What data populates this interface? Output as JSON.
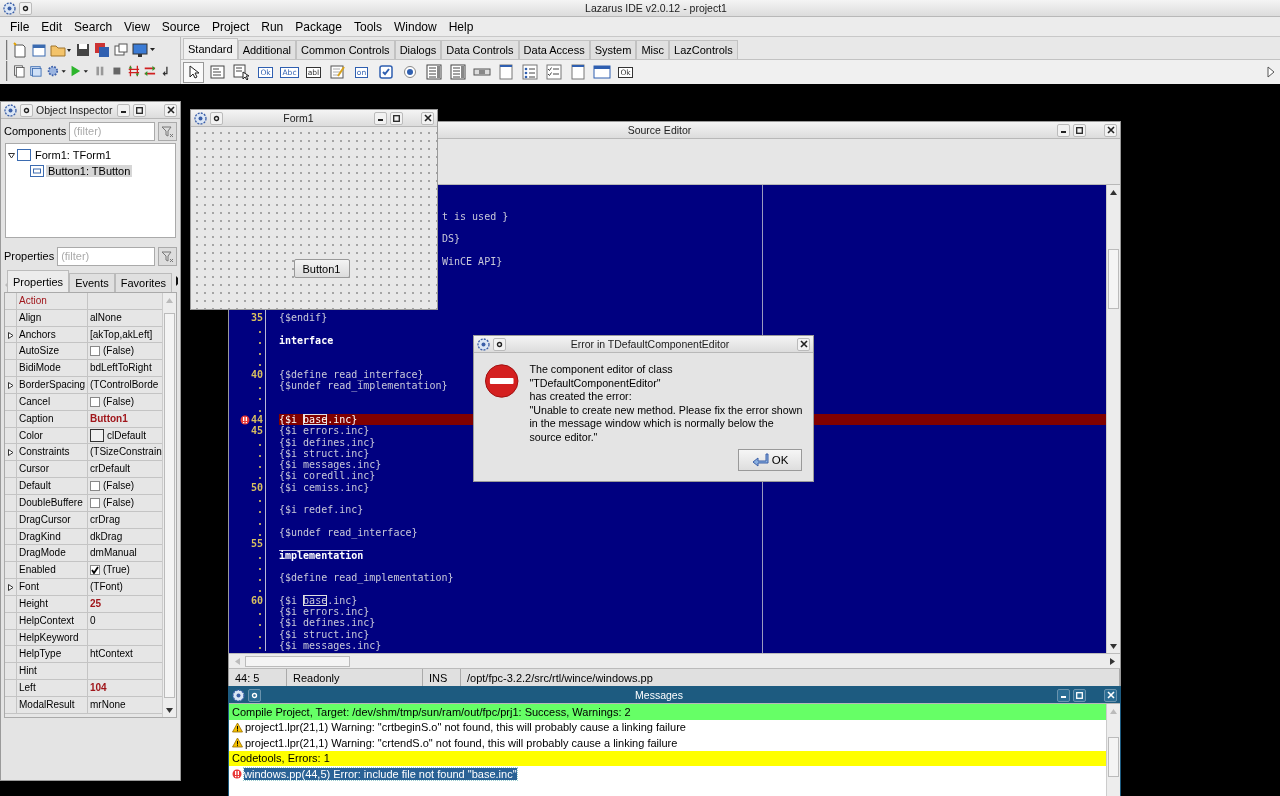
{
  "window": {
    "title": "Lazarus IDE v2.0.12 - project1"
  },
  "menu": [
    "File",
    "Edit",
    "Search",
    "View",
    "Source",
    "Project",
    "Run",
    "Package",
    "Tools",
    "Window",
    "Help"
  ],
  "palette": {
    "tabs": [
      {
        "label": "Standard",
        "selected": true
      },
      {
        "label": "Additional",
        "selected": false
      },
      {
        "label": "Common Controls",
        "selected": false
      },
      {
        "label": "Dialogs",
        "selected": false
      },
      {
        "label": "Data Controls",
        "selected": false
      },
      {
        "label": "Data Access",
        "selected": false
      },
      {
        "label": "System",
        "selected": false
      },
      {
        "label": "Misc",
        "selected": false
      },
      {
        "label": "LazControls",
        "selected": false
      }
    ],
    "items": [
      {
        "kind": "pointer",
        "selected": true
      },
      {
        "kind": "menu",
        "selected": false
      },
      {
        "kind": "popup",
        "selected": false
      },
      {
        "kind": "button",
        "label": "Ok",
        "selected": false
      },
      {
        "kind": "label",
        "label": "Abc",
        "selected": false
      },
      {
        "kind": "edit",
        "label": "abI",
        "selected": false
      },
      {
        "kind": "memo",
        "selected": false
      },
      {
        "kind": "toggle",
        "label": "on",
        "selected": false
      },
      {
        "kind": "check",
        "selected": false
      },
      {
        "kind": "radio",
        "selected": false
      },
      {
        "kind": "list",
        "selected": false
      },
      {
        "kind": "list",
        "selected": false
      },
      {
        "kind": "scrollbar",
        "selected": false
      },
      {
        "kind": "page",
        "selected": false
      },
      {
        "kind": "lines",
        "selected": false
      },
      {
        "kind": "checks",
        "selected": false
      },
      {
        "kind": "page",
        "selected": false
      },
      {
        "kind": "window",
        "selected": false
      },
      {
        "kind": "actionlist",
        "label": "Ok",
        "selected": false
      }
    ]
  },
  "object_inspector": {
    "title": "Object Inspector",
    "components_label": "Components",
    "components_filter": {
      "placeholder": "(filter)"
    },
    "tree": [
      {
        "label": "Form1: TForm1",
        "expanded": true,
        "selected": false,
        "children": [
          {
            "label": "Button1: TButton",
            "selected": true
          }
        ]
      }
    ],
    "properties_label": "Properties",
    "properties_filter": {
      "placeholder": "(filter)"
    },
    "tabs": [
      {
        "label": "Properties",
        "selected": true
      },
      {
        "label": "Events",
        "selected": false
      },
      {
        "label": "Favorites",
        "selected": false
      }
    ],
    "rows": [
      {
        "name": "Action",
        "kind": "text",
        "reference": true,
        "expandable": false
      },
      {
        "name": "Align",
        "value": "alNone",
        "kind": "text",
        "reference": false,
        "expandable": false,
        "modified": false
      },
      {
        "name": "Anchors",
        "value": "[akTop,akLeft]",
        "kind": "text",
        "reference": false,
        "expandable": true,
        "modified": false
      },
      {
        "name": "AutoSize",
        "value": "(False)",
        "kind": "check",
        "checked": false,
        "reference": false,
        "expandable": false,
        "modified": false
      },
      {
        "name": "BidiMode",
        "value": "bdLeftToRight",
        "kind": "text",
        "reference": false,
        "expandable": false,
        "modified": false
      },
      {
        "name": "BorderSpacing",
        "value": "(TControlBorde",
        "kind": "text",
        "reference": false,
        "expandable": true,
        "modified": false
      },
      {
        "name": "Cancel",
        "value": "(False)",
        "kind": "check",
        "checked": false,
        "reference": false,
        "expandable": false,
        "modified": false
      },
      {
        "name": "Caption",
        "value": "Button1",
        "kind": "text",
        "reference": false,
        "expandable": false,
        "modified": true
      },
      {
        "name": "Color",
        "value": "clDefault",
        "kind": "color",
        "color": "#f0f0f0",
        "reference": false,
        "expandable": false,
        "modified": false
      },
      {
        "name": "Constraints",
        "value": "(TSizeConstrain",
        "kind": "text",
        "reference": false,
        "expandable": true,
        "modified": false
      },
      {
        "name": "Cursor",
        "value": "crDefault",
        "kind": "text",
        "reference": false,
        "expandable": false,
        "modified": false
      },
      {
        "name": "Default",
        "value": "(False)",
        "kind": "check",
        "checked": false,
        "reference": false,
        "expandable": false,
        "modified": false
      },
      {
        "name": "DoubleBuffere",
        "value": "(False)",
        "kind": "check",
        "checked": false,
        "reference": false,
        "expandable": false,
        "modified": false
      },
      {
        "name": "DragCursor",
        "value": "crDrag",
        "kind": "text",
        "reference": false,
        "expandable": false,
        "modified": false
      },
      {
        "name": "DragKind",
        "value": "dkDrag",
        "kind": "text",
        "reference": false,
        "expandable": false,
        "modified": false
      },
      {
        "name": "DragMode",
        "value": "dmManual",
        "kind": "text",
        "reference": false,
        "expandable": false,
        "modified": false
      },
      {
        "name": "Enabled",
        "value": "(True)",
        "kind": "check",
        "checked": true,
        "reference": false,
        "expandable": false,
        "modified": false
      },
      {
        "name": "Font",
        "value": "(TFont)",
        "kind": "text",
        "reference": false,
        "expandable": true,
        "modified": false
      },
      {
        "name": "Height",
        "value": "25",
        "kind": "text",
        "reference": false,
        "expandable": false,
        "modified": true
      },
      {
        "name": "HelpContext",
        "value": "0",
        "kind": "text",
        "reference": false,
        "expandable": false,
        "modified": false
      },
      {
        "name": "HelpKeyword",
        "kind": "text",
        "reference": false,
        "expandable": false
      },
      {
        "name": "HelpType",
        "value": "htContext",
        "kind": "text",
        "reference": false,
        "expandable": false,
        "modified": false
      },
      {
        "name": "Hint",
        "kind": "text",
        "reference": false,
        "expandable": false
      },
      {
        "name": "Left",
        "value": "104",
        "kind": "text",
        "reference": false,
        "expandable": false,
        "modified": true
      },
      {
        "name": "ModalResult",
        "value": "mrNone",
        "kind": "text",
        "reference": false,
        "expandable": false,
        "modified": false
      }
    ]
  },
  "form_designer": {
    "title": "Form1",
    "button": "Button1"
  },
  "source_editor": {
    "title": "Source Editor",
    "lines": [
      {
        "kind": "blank"
      },
      {
        "kind": "blank"
      },
      {
        "kind": "partial",
        "code": "t is used }"
      },
      {
        "kind": "blank"
      },
      {
        "kind": "partial",
        "code": "DS}"
      },
      {
        "kind": "blank"
      },
      {
        "kind": "partial",
        "code": "WinCE API}"
      },
      {
        "kind": "blank"
      },
      {
        "kind": "blank"
      },
      {
        "kind": "blank"
      },
      {
        "kind": "blank"
      },
      {
        "kind": "directive",
        "gutter": "35",
        "code": "{$endif}"
      },
      {
        "kind": "blank",
        "gutter": "."
      },
      {
        "kind": "keyword",
        "gutter": ".",
        "code": "interface"
      },
      {
        "kind": "blank",
        "gutter": "."
      },
      {
        "kind": "blank",
        "gutter": "."
      },
      {
        "kind": "directive",
        "gutter": "40",
        "code": "{$define read_interface}"
      },
      {
        "kind": "directive",
        "gutter": ".",
        "code": "{$undef read_implementation}"
      },
      {
        "kind": "blank",
        "gutter": "."
      },
      {
        "kind": "blank",
        "gutter": "."
      },
      {
        "kind": "error",
        "gutter": "44",
        "parts": [
          {
            "text": "{$i ",
            "boxed": false
          },
          {
            "text": "base",
            "boxed": true
          },
          {
            "text": ".inc}",
            "boxed": false
          }
        ]
      },
      {
        "kind": "directive",
        "gutter": "45",
        "code": "{$i errors.inc}"
      },
      {
        "kind": "directive",
        "gutter": ".",
        "code": "{$i defines.inc}"
      },
      {
        "kind": "directive",
        "gutter": ".",
        "code": "{$i struct.inc}"
      },
      {
        "kind": "directive",
        "gutter": ".",
        "code": "{$i messages.inc}"
      },
      {
        "kind": "directive",
        "gutter": ".",
        "code": "{$i coredll.inc}"
      },
      {
        "kind": "directive",
        "gutter": "50",
        "code": "{$i cemiss.inc}"
      },
      {
        "kind": "blank",
        "gutter": "."
      },
      {
        "kind": "directive",
        "gutter": ".",
        "code": "{$i redef.inc}"
      },
      {
        "kind": "blank",
        "gutter": "."
      },
      {
        "kind": "directive",
        "gutter": ".",
        "code": "{$undef read_interface}"
      },
      {
        "kind": "blank",
        "gutter": "55"
      },
      {
        "kind": "section",
        "gutter": ".",
        "code": "implementation"
      },
      {
        "kind": "blank",
        "gutter": "."
      },
      {
        "kind": "directive",
        "gutter": ".",
        "code": "{$define read_implementation}"
      },
      {
        "kind": "blank",
        "gutter": "."
      },
      {
        "kind": "match",
        "gutter": "60",
        "parts": [
          {
            "text": "{$i ",
            "boxed": false
          },
          {
            "text": "base",
            "boxed": true
          },
          {
            "text": ".inc}",
            "boxed": false
          }
        ]
      },
      {
        "kind": "directive",
        "gutter": ".",
        "code": "{$i errors.inc}"
      },
      {
        "kind": "directive",
        "gutter": ".",
        "code": "{$i defines.inc}"
      },
      {
        "kind": "directive",
        "gutter": ".",
        "code": "{$i struct.inc}"
      },
      {
        "kind": "directive",
        "gutter": ".",
        "code": "{$i messages.inc}"
      }
    ],
    "status_bar": [
      "44: 5",
      "Readonly",
      "INS",
      "/opt/fpc-3.2.2/src/rtl/wince/windows.pp"
    ]
  },
  "error_dialog": {
    "title": "Error in TDefaultComponentEditor",
    "message": "The component editor of class \"TDefaultComponentEditor\"\nhas created the error:\n\"Unable to create new method. Please fix the error shown in the message window which is normally below the source editor.\"",
    "button": "OK"
  },
  "messages": {
    "title": "Messages",
    "rows": [
      {
        "kind": "group",
        "text": "Compile Project, Target: /dev/shm/tmp/sun/ram/out/fpc/prj1: Success, Warnings: 2",
        "color": "#66ff66",
        "selected": false
      },
      {
        "kind": "warning",
        "text": "project1.lpr(21,1) Warning: \"crtbeginS.o\" not found, this will probably cause a linking failure",
        "selected": false
      },
      {
        "kind": "warning",
        "text": "project1.lpr(21,1) Warning: \"crtendS.o\" not found, this will probably cause a linking failure",
        "selected": false
      },
      {
        "kind": "group",
        "text": "Codetools, Errors: 1",
        "color": "#ffff00",
        "selected": false
      },
      {
        "kind": "error",
        "text": "windows.pp(44,5) Error: include file not found \"base.inc\"",
        "selected": true
      }
    ]
  }
}
